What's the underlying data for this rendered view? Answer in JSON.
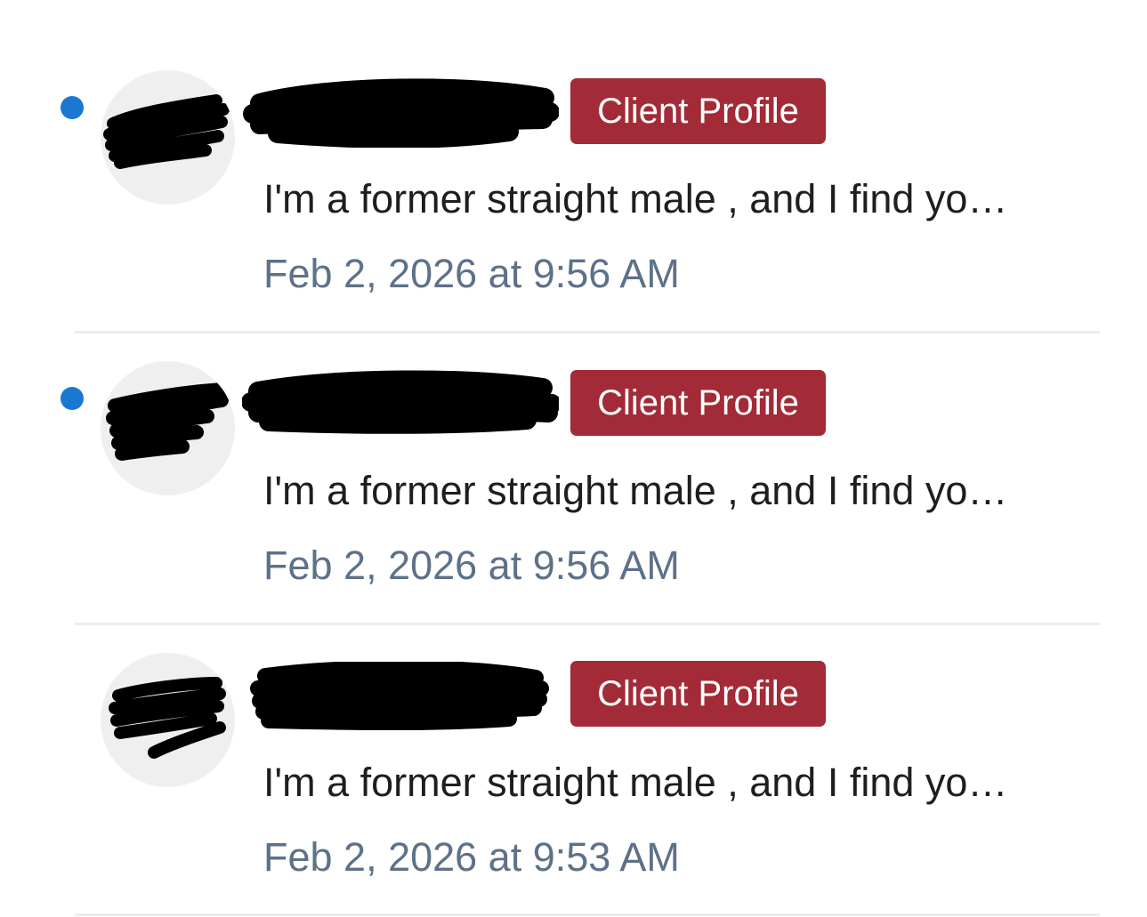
{
  "colors": {
    "unread_dot": "#1a78d2",
    "button_background": "#a22b37",
    "button_text": "#ffffff",
    "preview_text": "#1e1e1e",
    "timestamp_text": "#5d7188",
    "divider": "#ececec",
    "avatar_background": "#efefef",
    "redaction": "#000000"
  },
  "messages": [
    {
      "unread": true,
      "button_label": "Client Profile",
      "preview": "I'm a former straight male , and I find yo…",
      "timestamp": "Feb 2, 2026 at 9:56 AM"
    },
    {
      "unread": true,
      "button_label": "Client Profile",
      "preview": "I'm a former straight male , and I find yo…",
      "timestamp": "Feb 2, 2026 at 9:56 AM"
    },
    {
      "unread": false,
      "button_label": "Client Profile",
      "preview": "I'm a former straight male , and I find yo…",
      "timestamp": "Feb 2, 2026 at 9:53 AM"
    }
  ]
}
